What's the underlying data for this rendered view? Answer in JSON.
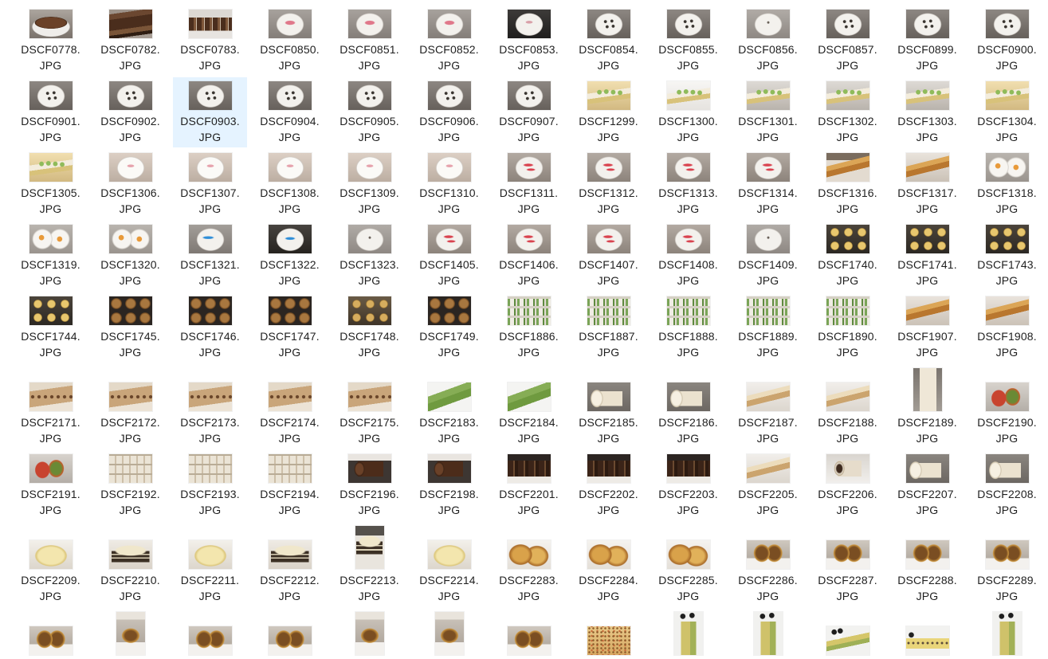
{
  "selection_color": "#e5f3ff",
  "files": [
    {
      "name": "DSCF0778.JPG"
    },
    {
      "name": "DSCF0782.JPG"
    },
    {
      "name": "DSCF0783.JPG"
    },
    {
      "name": "DSCF0850.JPG"
    },
    {
      "name": "DSCF0851.JPG"
    },
    {
      "name": "DSCF0852.JPG"
    },
    {
      "name": "DSCF0853.JPG"
    },
    {
      "name": "DSCF0854.JPG"
    },
    {
      "name": "DSCF0855.JPG"
    },
    {
      "name": "DSCF0856.JPG"
    },
    {
      "name": "DSCF0857.JPG"
    },
    {
      "name": "DSCF0899.JPG"
    },
    {
      "name": "DSCF0900.JPG"
    },
    {
      "name": "DSCF0901.JPG"
    },
    {
      "name": "DSCF0902.JPG"
    },
    {
      "name": "DSCF0903.JPG",
      "selected": true
    },
    {
      "name": "DSCF0904.JPG"
    },
    {
      "name": "DSCF0905.JPG"
    },
    {
      "name": "DSCF0906.JPG"
    },
    {
      "name": "DSCF0907.JPG"
    },
    {
      "name": "DSCF1299.JPG"
    },
    {
      "name": "DSCF1300.JPG"
    },
    {
      "name": "DSCF1301.JPG"
    },
    {
      "name": "DSCF1302.JPG"
    },
    {
      "name": "DSCF1303.JPG"
    },
    {
      "name": "DSCF1304.JPG"
    },
    {
      "name": "DSCF1305.JPG"
    },
    {
      "name": "DSCF1306.JPG"
    },
    {
      "name": "DSCF1307.JPG"
    },
    {
      "name": "DSCF1308.JPG"
    },
    {
      "name": "DSCF1309.JPG"
    },
    {
      "name": "DSCF1310.JPG"
    },
    {
      "name": "DSCF1311.JPG"
    },
    {
      "name": "DSCF1312.JPG"
    },
    {
      "name": "DSCF1313.JPG"
    },
    {
      "name": "DSCF1314.JPG"
    },
    {
      "name": "DSCF1316.JPG"
    },
    {
      "name": "DSCF1317.JPG"
    },
    {
      "name": "DSCF1318.JPG"
    },
    {
      "name": "DSCF1319.JPG"
    },
    {
      "name": "DSCF1320.JPG"
    },
    {
      "name": "DSCF1321.JPG"
    },
    {
      "name": "DSCF1322.JPG"
    },
    {
      "name": "DSCF1323.JPG"
    },
    {
      "name": "DSCF1405.JPG"
    },
    {
      "name": "DSCF1406.JPG"
    },
    {
      "name": "DSCF1407.JPG"
    },
    {
      "name": "DSCF1408.JPG"
    },
    {
      "name": "DSCF1409.JPG"
    },
    {
      "name": "DSCF1740.JPG"
    },
    {
      "name": "DSCF1741.JPG"
    },
    {
      "name": "DSCF1743.JPG"
    },
    {
      "name": "DSCF1744.JPG"
    },
    {
      "name": "DSCF1745.JPG"
    },
    {
      "name": "DSCF1746.JPG"
    },
    {
      "name": "DSCF1747.JPG"
    },
    {
      "name": "DSCF1748.JPG"
    },
    {
      "name": "DSCF1749.JPG"
    },
    {
      "name": "DSCF1886.JPG"
    },
    {
      "name": "DSCF1887.JPG"
    },
    {
      "name": "DSCF1888.JPG"
    },
    {
      "name": "DSCF1889.JPG"
    },
    {
      "name": "DSCF1890.JPG"
    },
    {
      "name": "DSCF1907.JPG"
    },
    {
      "name": "DSCF1908.JPG"
    },
    {
      "name": "DSCF2171.JPG"
    },
    {
      "name": "DSCF2172.JPG"
    },
    {
      "name": "DSCF2173.JPG"
    },
    {
      "name": "DSCF2174.JPG"
    },
    {
      "name": "DSCF2175.JPG"
    },
    {
      "name": "DSCF2183.JPG"
    },
    {
      "name": "DSCF2184.JPG"
    },
    {
      "name": "DSCF2185.JPG"
    },
    {
      "name": "DSCF2186.JPG"
    },
    {
      "name": "DSCF2187.JPG"
    },
    {
      "name": "DSCF2188.JPG"
    },
    {
      "name": "DSCF2189.JPG"
    },
    {
      "name": "DSCF2190.JPG"
    },
    {
      "name": "DSCF2191.JPG"
    },
    {
      "name": "DSCF2192.JPG"
    },
    {
      "name": "DSCF2193.JPG"
    },
    {
      "name": "DSCF2194.JPG"
    },
    {
      "name": "DSCF2196.JPG"
    },
    {
      "name": "DSCF2198.JPG"
    },
    {
      "name": "DSCF2201.JPG"
    },
    {
      "name": "DSCF2202.JPG"
    },
    {
      "name": "DSCF2203.JPG"
    },
    {
      "name": "DSCF2205.JPG"
    },
    {
      "name": "DSCF2206.JPG"
    },
    {
      "name": "DSCF2207.JPG"
    },
    {
      "name": "DSCF2208.JPG"
    },
    {
      "name": "DSCF2209.JPG"
    },
    {
      "name": "DSCF2210.JPG"
    },
    {
      "name": "DSCF2211.JPG"
    },
    {
      "name": "DSCF2212.JPG"
    },
    {
      "name": "DSCF2213.JPG"
    },
    {
      "name": "DSCF2214.JPG"
    },
    {
      "name": "DSCF2283.JPG"
    },
    {
      "name": "DSCF2284.JPG"
    },
    {
      "name": "DSCF2285.JPG"
    },
    {
      "name": "DSCF2286.JPG"
    },
    {
      "name": "DSCF2287.JPG"
    },
    {
      "name": "DSCF2288.JPG"
    },
    {
      "name": "DSCF2289.JPG"
    }
  ]
}
